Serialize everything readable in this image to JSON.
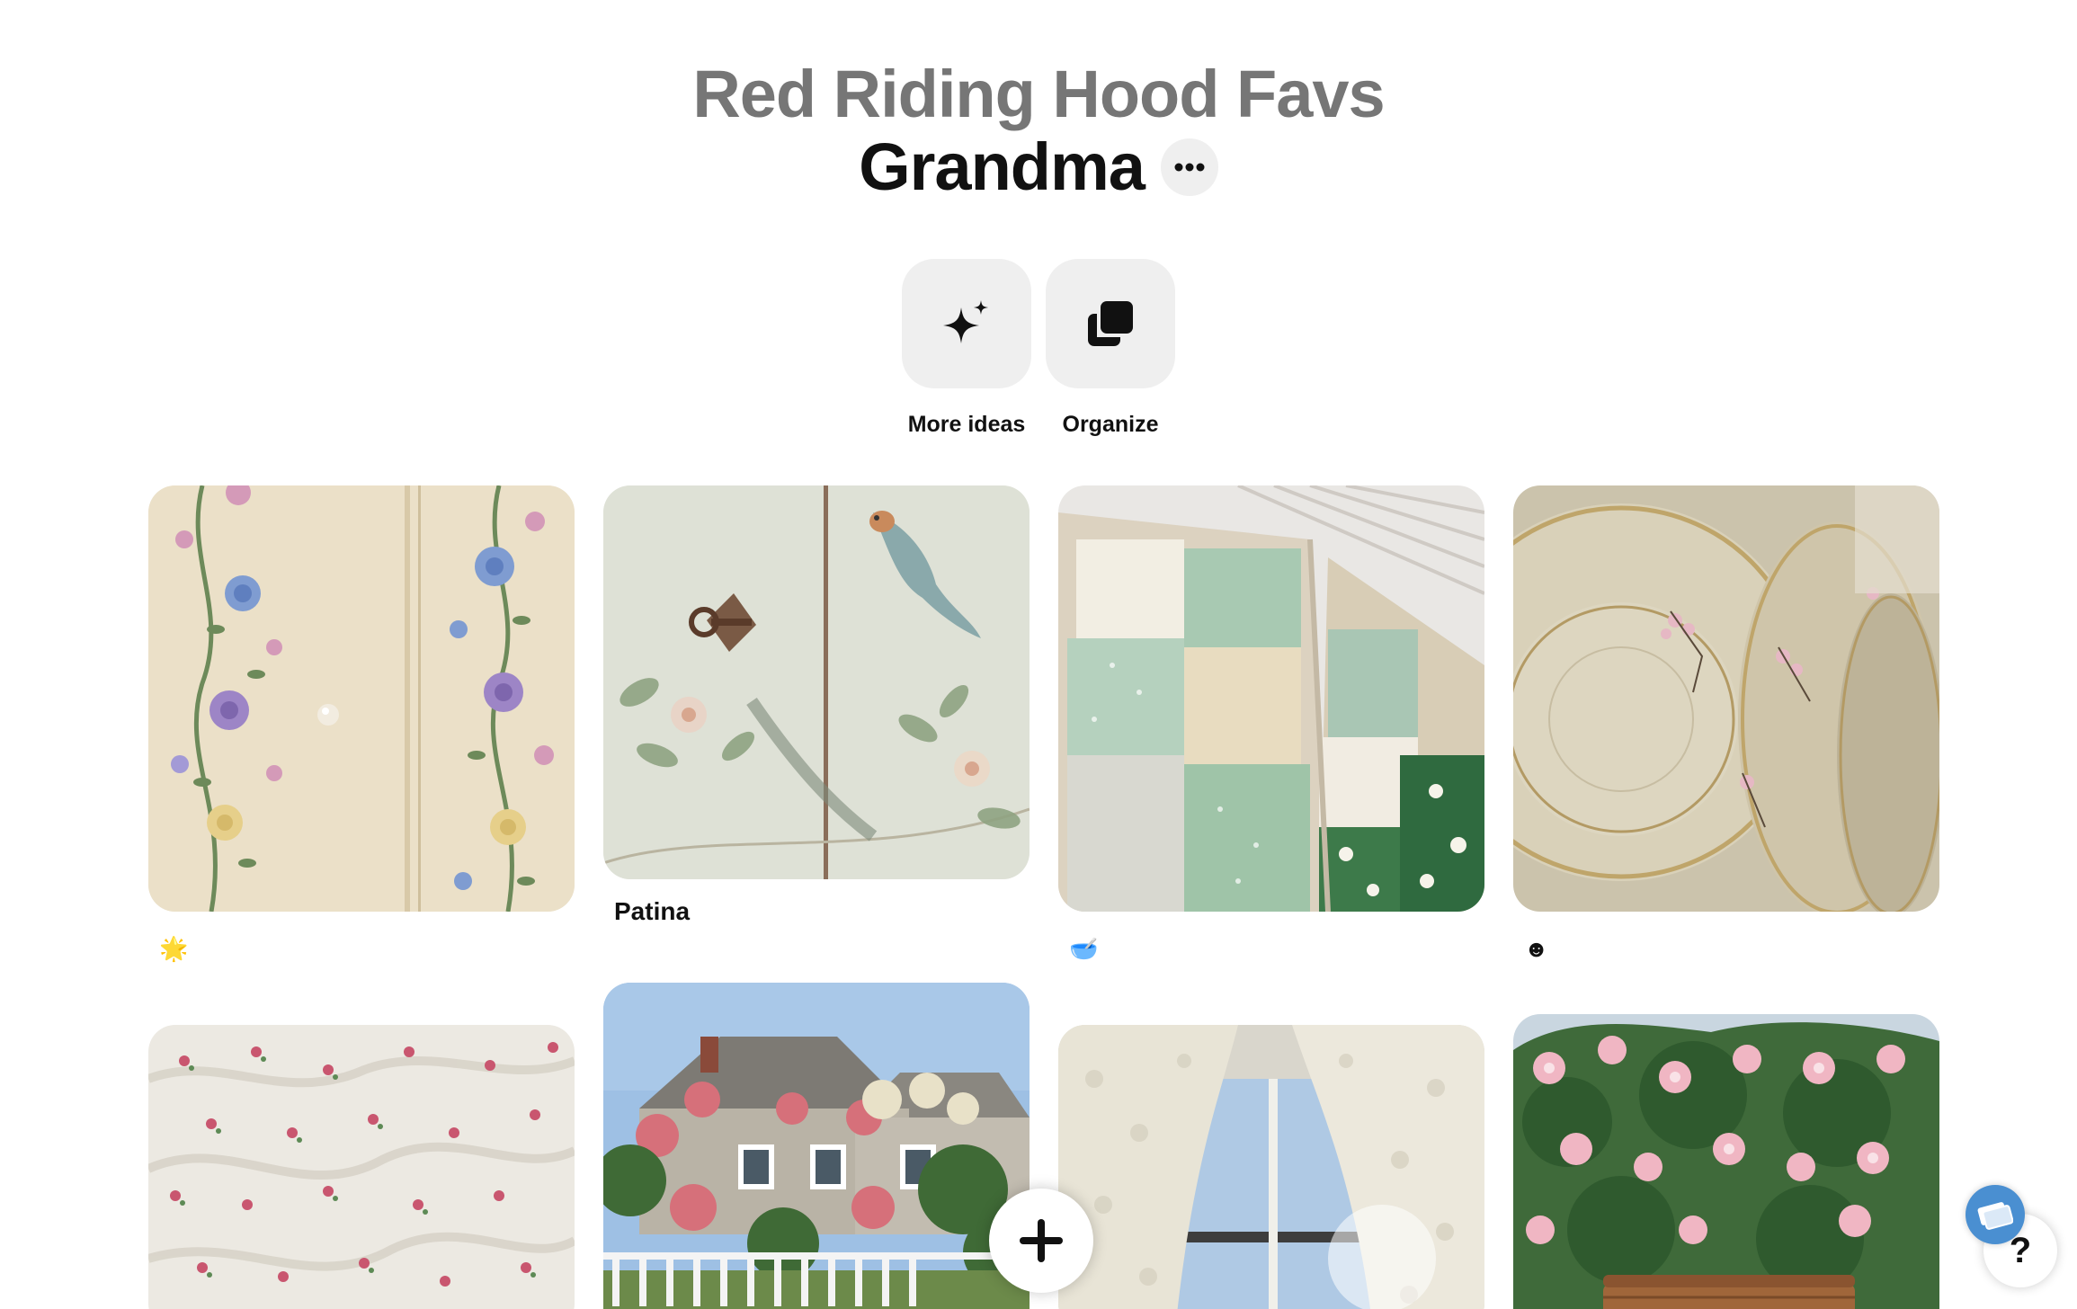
{
  "board": {
    "parent_title": "Red Riding Hood Favs",
    "title": "Grandma",
    "more_icon": "ellipsis-icon"
  },
  "actions": [
    {
      "label": "More ideas",
      "icon": "sparkle-icon"
    },
    {
      "label": "Organize",
      "icon": "organize-icon"
    }
  ],
  "pins": [
    {
      "image": "embroidered-cardigan",
      "caption": "🌟",
      "caption_type": "emoji"
    },
    {
      "image": "painted-door-with-key",
      "caption": "Patina",
      "caption_type": "title"
    },
    {
      "image": "patchwork-quilt",
      "caption": "🥣",
      "caption_type": "emoji"
    },
    {
      "image": "floral-china-plates",
      "caption": "☻",
      "caption_type": "emoji"
    },
    {
      "image": "rose-print-bedding",
      "caption": "",
      "caption_type": "none"
    },
    {
      "image": "cottage-with-roses",
      "caption": "",
      "caption_type": "none"
    },
    {
      "image": "lace-curtain-window",
      "caption": "",
      "caption_type": "none"
    },
    {
      "image": "rose-bush-and-basket",
      "caption": "",
      "caption_type": "none"
    }
  ],
  "floating": {
    "add_icon": "plus-icon",
    "help_label": "?",
    "help_badge_icon": "tickets-icon"
  },
  "colors": {
    "parent_title": "#767676",
    "title": "#111111",
    "button_bg": "#efefef",
    "help_badge": "#4a8fd1"
  }
}
